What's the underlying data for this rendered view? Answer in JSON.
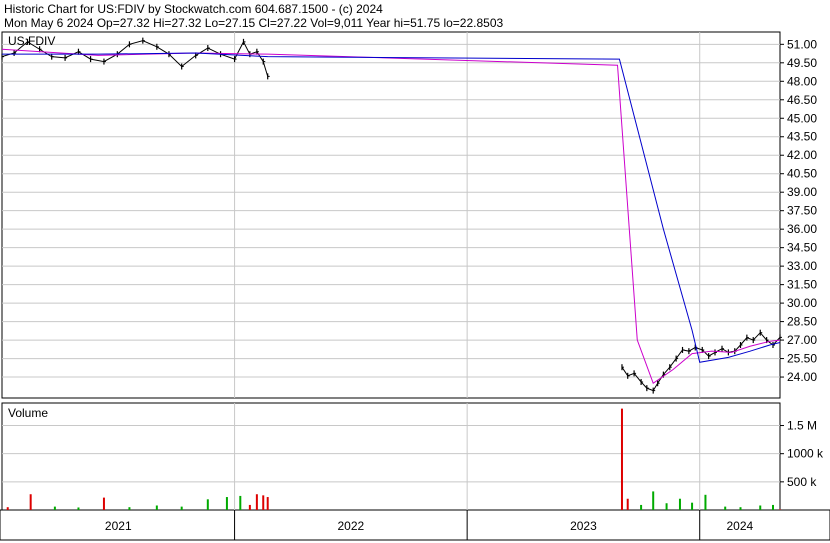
{
  "header": {
    "line1": "Historic Chart for US:FDIV by Stockwatch.com 604.687.1500 - (c) 2024",
    "line2": "Mon May  6 2024   Op=27.32   Hi=27.32   Lo=27.15   Cl=27.22   Vol=9,011   Year hi=51.75   lo=22.8503"
  },
  "colors": {
    "ma_short": "#cc00cc",
    "ma_long": "#0000cc",
    "price": "#000000",
    "volume_up": "#00aa00",
    "volume_down": "#dd0000",
    "grid": "#c8c8c8"
  },
  "chart_data": [
    {
      "type": "line",
      "title": "",
      "legend": "US:FDIV",
      "xlabel": "",
      "ylabel": "",
      "y_axis_side": "right",
      "ylim": [
        22.3,
        52.0
      ],
      "grid": true,
      "yticks": [
        "51.00",
        "49.50",
        "48.00",
        "46.50",
        "45.00",
        "43.50",
        "42.00",
        "40.50",
        "39.00",
        "37.50",
        "36.00",
        "34.50",
        "33.00",
        "31.50",
        "30.00",
        "28.50",
        "27.00",
        "25.50",
        "24.00"
      ],
      "x_labels": [
        "2021",
        "2022",
        "2023",
        "2024"
      ],
      "x_range": [
        "2021-01-01",
        "2024-05-06"
      ],
      "series": [
        {
          "role": "price",
          "style": "daily bars",
          "x": [
            "2021-01-01",
            "2021-01-20",
            "2021-02-10",
            "2021-03-01",
            "2021-03-20",
            "2021-04-10",
            "2021-05-01",
            "2021-05-20",
            "2021-06-10",
            "2021-07-01",
            "2021-07-20",
            "2021-08-10",
            "2021-09-01",
            "2021-09-20",
            "2021-10-10",
            "2021-11-01",
            "2021-11-20",
            "2021-12-10",
            "2022-01-01",
            "2022-01-15",
            "2022-01-25",
            "2022-02-05",
            "2022-02-15",
            "2022-02-22",
            "2023-09-01",
            "2023-09-10",
            "2023-09-20",
            "2023-10-01",
            "2023-10-10",
            "2023-10-20",
            "2023-10-27",
            "2023-11-05",
            "2023-11-15",
            "2023-11-25",
            "2023-12-05",
            "2023-12-15",
            "2023-12-25",
            "2024-01-05",
            "2024-01-15",
            "2024-01-25",
            "2024-02-05",
            "2024-02-15",
            "2024-02-25",
            "2024-03-05",
            "2024-03-15",
            "2024-03-25",
            "2024-04-05",
            "2024-04-15",
            "2024-04-25",
            "2024-05-06"
          ],
          "values": [
            50.0,
            50.3,
            51.2,
            50.6,
            50.0,
            49.9,
            50.4,
            49.8,
            49.6,
            50.2,
            51.0,
            51.3,
            50.8,
            50.2,
            49.2,
            50.1,
            50.7,
            50.2,
            49.8,
            51.2,
            50.2,
            50.4,
            49.6,
            48.4,
            24.8,
            24.1,
            24.3,
            23.6,
            23.1,
            22.9,
            23.5,
            24.2,
            24.8,
            25.5,
            26.2,
            26.1,
            26.4,
            26.2,
            25.7,
            26.0,
            26.3,
            26.0,
            26.1,
            26.6,
            27.2,
            27.0,
            27.6,
            27.0,
            26.6,
            27.22
          ]
        },
        {
          "role": "moving average (short)",
          "color": "#cc00cc",
          "x": [
            "2021-01-01",
            "2021-06-01",
            "2021-11-01",
            "2022-02-22",
            "2023-08-25",
            "2023-09-25",
            "2023-10-20",
            "2023-11-20",
            "2023-12-20",
            "2024-01-20",
            "2024-02-20",
            "2024-03-20",
            "2024-04-20",
            "2024-05-06"
          ],
          "values": [
            50.6,
            50.1,
            50.3,
            50.2,
            49.3,
            27.0,
            23.5,
            24.6,
            25.9,
            26.1,
            26.0,
            26.5,
            26.9,
            27.0
          ]
        },
        {
          "role": "moving average (long)",
          "color": "#0000cc",
          "x": [
            "2021-01-01",
            "2021-06-01",
            "2021-11-01",
            "2022-02-22",
            "2023-08-28",
            "2023-11-05",
            "2023-12-20",
            "2024-01-01",
            "2024-02-15",
            "2024-03-20",
            "2024-04-20",
            "2024-05-06"
          ],
          "values": [
            50.2,
            50.2,
            50.3,
            50.0,
            49.8,
            36.0,
            27.8,
            25.2,
            25.6,
            26.1,
            26.6,
            26.8
          ]
        }
      ]
    },
    {
      "type": "bar",
      "title": "Volume",
      "y_axis_side": "right",
      "ylim": [
        0,
        1900000
      ],
      "yticks": [
        "1.5 M",
        "1000 k",
        "500 k"
      ],
      "x_labels": [
        "2021",
        "2022",
        "2023",
        "2024"
      ],
      "x": [
        "2021-01-10",
        "2021-02-15",
        "2021-03-25",
        "2021-05-01",
        "2021-06-10",
        "2021-07-20",
        "2021-09-01",
        "2021-10-10",
        "2021-11-20",
        "2021-12-20",
        "2022-01-10",
        "2022-01-25",
        "2022-02-05",
        "2022-02-15",
        "2022-02-22",
        "2023-09-01",
        "2023-09-10",
        "2023-10-01",
        "2023-10-20",
        "2023-11-10",
        "2023-12-01",
        "2023-12-20",
        "2024-01-10",
        "2024-02-10",
        "2024-03-05",
        "2024-04-05",
        "2024-04-25",
        "2024-05-06"
      ],
      "values": [
        50000,
        280000,
        60000,
        45000,
        220000,
        50000,
        80000,
        60000,
        190000,
        230000,
        250000,
        90000,
        280000,
        260000,
        230000,
        1800000,
        200000,
        90000,
        330000,
        120000,
        200000,
        130000,
        270000,
        60000,
        50000,
        80000,
        90000,
        9011
      ],
      "direction": [
        "down",
        "down",
        "up",
        "up",
        "down",
        "up",
        "up",
        "up",
        "up",
        "up",
        "up",
        "down",
        "down",
        "down",
        "down",
        "down",
        "down",
        "up",
        "up",
        "up",
        "up",
        "up",
        "up",
        "up",
        "up",
        "up",
        "up",
        "down"
      ]
    }
  ]
}
